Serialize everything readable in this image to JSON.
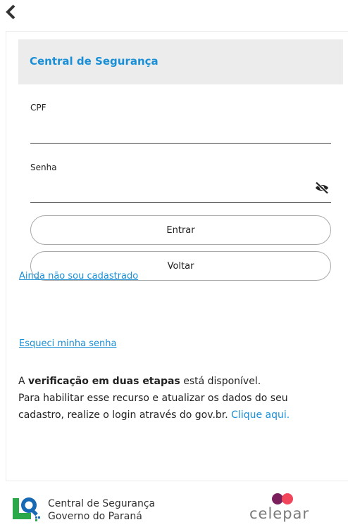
{
  "nav": {
    "back_icon": "chevron-left-icon"
  },
  "card": {
    "title": "Central de Segurança"
  },
  "form": {
    "cpf_label": "CPF",
    "cpf_value": "",
    "senha_label": "Senha",
    "senha_value": "",
    "visibility_icon": "eye-off-icon",
    "entrar_label": "Entrar",
    "voltar_label": "Voltar"
  },
  "links": {
    "cadastro": "Ainda não sou cadastrado",
    "esqueci": "Esqueci minha senha"
  },
  "info": {
    "prefix": "A ",
    "highlight": "verificação em duas etapas",
    "line1_rest": " está disponível.",
    "line2": "Para habilitar esse recurso e atualizar os dados do seu",
    "line3": "cadastro, realize o login através do gov.br. ",
    "link": "Clique aqui."
  },
  "footer": {
    "brand_line1": "Central de Segurança",
    "brand_line2": "Governo do Paraná",
    "partner": "celepar"
  },
  "colors": {
    "accent": "#1a8fd6",
    "header_bg": "#ececec",
    "logo_blue": "#1769b3",
    "logo_green": "#2aa84a",
    "celepar_purple": "#7a1f5c",
    "celepar_red": "#f0455a"
  }
}
